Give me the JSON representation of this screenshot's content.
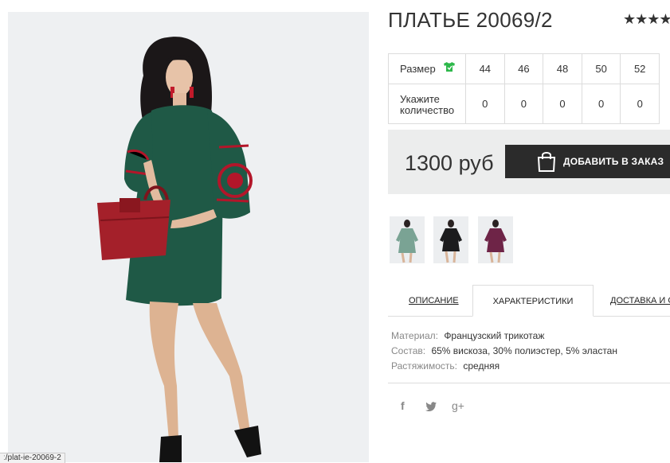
{
  "product": {
    "title": "ПЛАТЬЕ 20069/2",
    "rating_stars": "★★★★",
    "photo_alt": "dress-photo"
  },
  "status_url": "ː/plat-ie-20069-2",
  "sizes": {
    "row_label": "Размер",
    "qty_label_1": "Укажите",
    "qty_label_2": "количество",
    "values": [
      "44",
      "46",
      "48",
      "50",
      "52"
    ],
    "quantities": [
      "0",
      "0",
      "0",
      "0",
      "0"
    ]
  },
  "purchase": {
    "price": "1300 руб",
    "add_to_cart_label": "ДОБАВИТЬ В ЗАКАЗ"
  },
  "thumbnails": [
    {
      "color_name": "green",
      "dress_color": "#7aa394"
    },
    {
      "color_name": "black",
      "dress_color": "#1c1c1e"
    },
    {
      "color_name": "plum",
      "dress_color": "#6e2447"
    }
  ],
  "tabs": [
    {
      "label": "ОПИСАНИЕ",
      "active": false
    },
    {
      "label": "ХАРАКТЕРИСТИКИ",
      "active": true
    },
    {
      "label": "ДОСТАВКА И О",
      "active": false
    }
  ],
  "specs": [
    {
      "label": "Материал:",
      "value": "Французский трикотаж"
    },
    {
      "label": "Состав:",
      "value": "65% вискоза, 30% полиэстер, 5% эластан"
    },
    {
      "label": "Растяжимость:",
      "value": "средняя"
    }
  ],
  "social": {
    "facebook": "f",
    "twitter": "twitter-bird",
    "googleplus": "g+"
  },
  "colors": {
    "dress_green": "#1f5946",
    "embroidery_red": "#b3162a",
    "button_dark": "#2b2b2b",
    "price_bg": "#eceded",
    "size_icon_green": "#2eb84b"
  }
}
